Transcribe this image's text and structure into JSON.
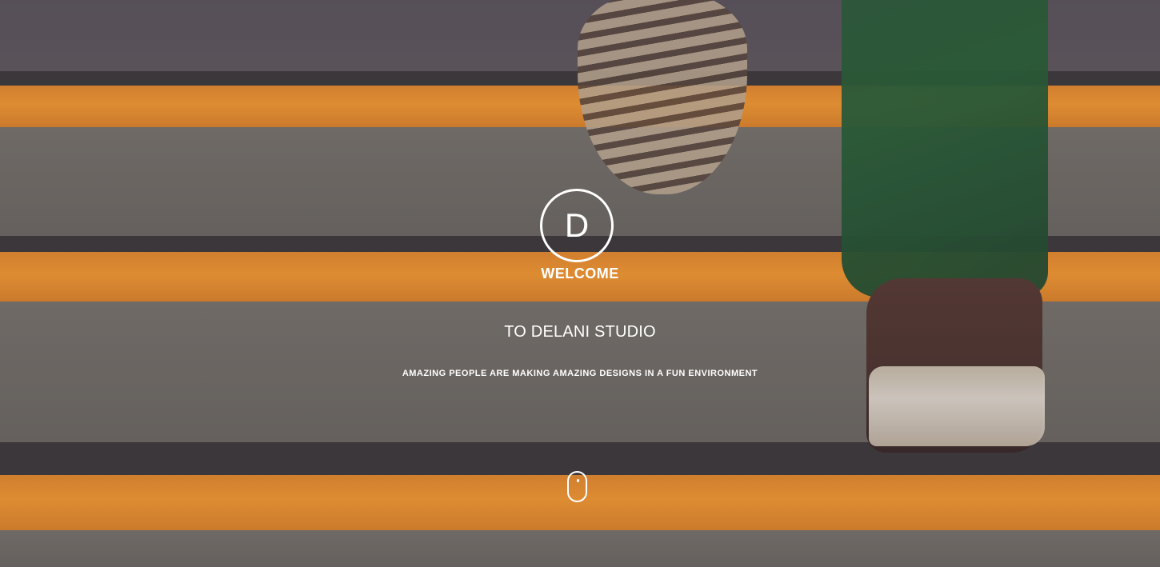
{
  "hero": {
    "logo_letter": "D",
    "welcome": "WELCOME",
    "studio": "TO DELANI STUDIO",
    "subtitle": "AMAZING PEOPLE ARE MAKING AMAZING DESIGNS IN A FUN ENVIRONMENT"
  },
  "icons": {
    "logo": "logo-circle-icon",
    "scroll": "mouse-scroll-icon"
  },
  "colors": {
    "text": "#ffffff",
    "stair_orange": "#ff9f33",
    "stair_gray": "#7b7670",
    "overlay": "#342b31"
  }
}
